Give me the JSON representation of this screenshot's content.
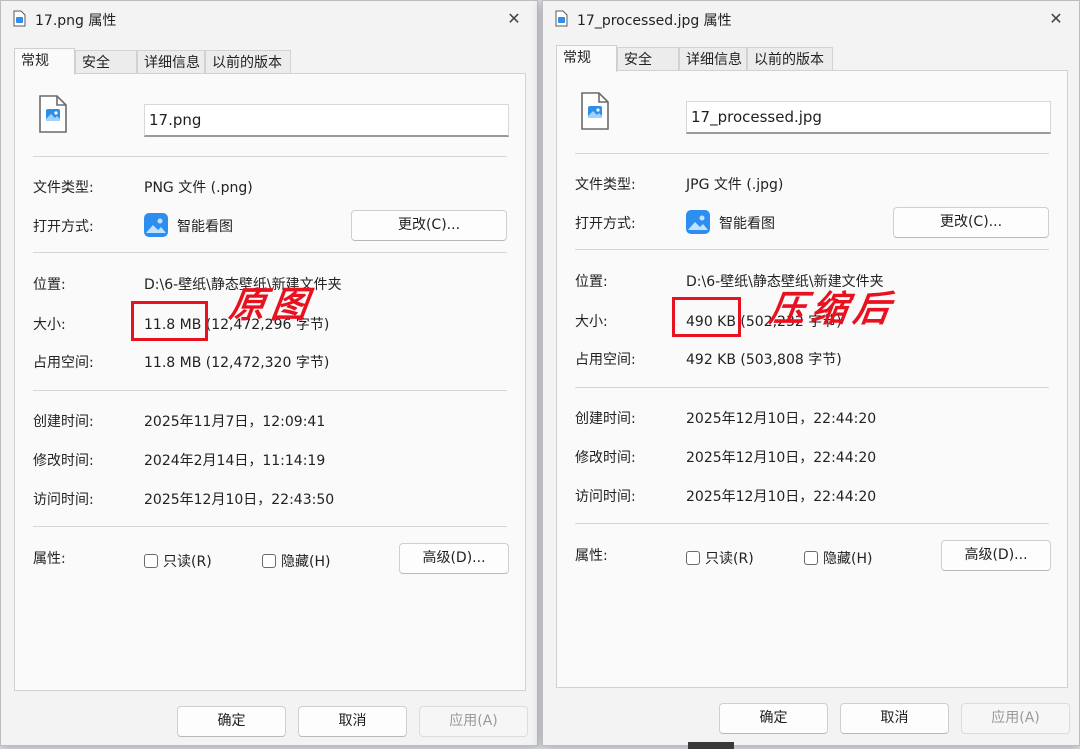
{
  "tabs": [
    "常规",
    "安全",
    "详细信息",
    "以前的版本"
  ],
  "labels": {
    "file_type": "文件类型:",
    "open_with": "打开方式:",
    "location": "位置:",
    "size": "大小:",
    "size_on_disk": "占用空间:",
    "created": "创建时间:",
    "modified": "修改时间:",
    "accessed": "访问时间:",
    "attributes": "属性:"
  },
  "buttons": {
    "change": "更改(C)...",
    "advanced": "高级(D)...",
    "ok": "确定",
    "cancel": "取消",
    "apply": "应用(A)"
  },
  "checkboxes": {
    "readonly": "只读(R)",
    "hidden": "隐藏(H)"
  },
  "close_glyph": "✕",
  "accent_red": "#e8111f",
  "original": {
    "title": "17.png 属性",
    "filename": "17.png",
    "file_type": "PNG 文件 (.png)",
    "open_with": "智能看图",
    "location": "D:\\6-壁纸\\静态壁纸\\新建文件夹",
    "size_highlight": "11.8 MB",
    "size_rest": "(12,472,296 字节)",
    "size_on_disk": "11.8 MB (12,472,320 字节)",
    "created": "2025年11月7日，12:09:41",
    "modified": "2024年2月14日，11:14:19",
    "accessed": "2025年12月10日，22:43:50",
    "annotation": "原图"
  },
  "processed": {
    "title": "17_processed.jpg 属性",
    "filename": "17_processed.jpg",
    "file_type": "JPG 文件 (.jpg)",
    "open_with": "智能看图",
    "location": "D:\\6-壁纸\\静态壁纸\\新建文件夹",
    "size_highlight": "490 KB",
    "size_rest": "(502,232 字节)",
    "size_on_disk": "492 KB (503,808 字节)",
    "created": "2025年12月10日，22:44:20",
    "modified": "2025年12月10日，22:44:20",
    "accessed": "2025年12月10日，22:44:20",
    "annotation": "压缩后"
  }
}
